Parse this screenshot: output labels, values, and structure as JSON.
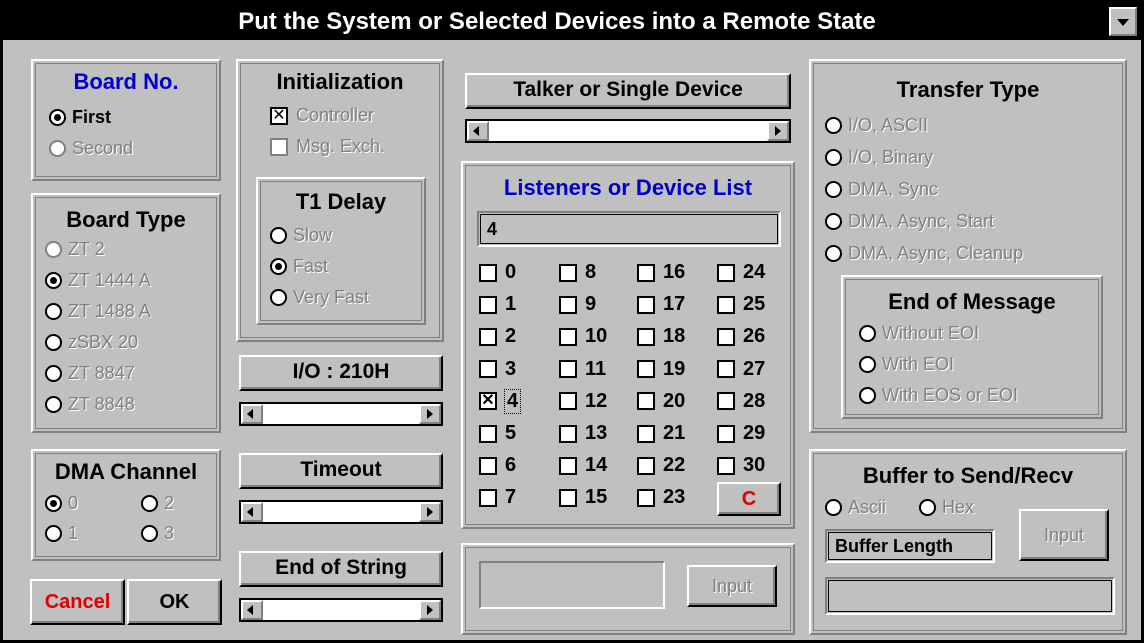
{
  "title": "Put the System or Selected Devices into a Remote State",
  "board_no": {
    "title": "Board No.",
    "options": [
      {
        "label": "First",
        "selected": true,
        "enabled": true
      },
      {
        "label": "Second",
        "selected": false,
        "enabled": false
      }
    ]
  },
  "board_type": {
    "title": "Board Type",
    "options": [
      {
        "label": "ZT 2",
        "selected": false
      },
      {
        "label": "ZT 1444 A",
        "selected": true
      },
      {
        "label": "ZT 1488 A",
        "selected": false
      },
      {
        "label": "zSBX 20",
        "selected": false
      },
      {
        "label": "ZT 8847",
        "selected": false
      },
      {
        "label": "ZT 8848",
        "selected": false
      }
    ]
  },
  "dma_channel": {
    "title": "DMA Channel",
    "options": [
      {
        "label": "0",
        "selected": true
      },
      {
        "label": "2",
        "selected": false
      },
      {
        "label": "1",
        "selected": false
      },
      {
        "label": "3",
        "selected": false
      }
    ]
  },
  "buttons": {
    "cancel": "Cancel",
    "ok": "OK"
  },
  "initialization": {
    "title": "Initialization",
    "controller": {
      "label": "Controller",
      "checked": true
    },
    "msg_exch": {
      "label": "Msg. Exch.",
      "checked": false
    }
  },
  "t1_delay": {
    "title": "T1 Delay",
    "options": [
      {
        "label": "Slow",
        "selected": false
      },
      {
        "label": "Fast",
        "selected": true
      },
      {
        "label": "Very Fast",
        "selected": false
      }
    ]
  },
  "io": {
    "label": "I/O : 210H"
  },
  "timeout": {
    "label": "Timeout"
  },
  "end_of_string": {
    "label": "End of String"
  },
  "talker": {
    "label": "Talker or Single Device"
  },
  "listeners": {
    "title": "Listeners or Device List",
    "value": "4",
    "checked": [
      4
    ],
    "clear_label": "C"
  },
  "bottom_input": {
    "label": "Input"
  },
  "transfer_type": {
    "title": "Transfer Type",
    "options": [
      {
        "label": "I/O, ASCII",
        "selected": false
      },
      {
        "label": "I/O, Binary",
        "selected": false
      },
      {
        "label": "DMA, Sync",
        "selected": false
      },
      {
        "label": "DMA, Async, Start",
        "selected": false
      },
      {
        "label": "DMA, Async, Cleanup",
        "selected": false
      }
    ]
  },
  "end_of_message": {
    "title": "End of Message",
    "options": [
      {
        "label": "Without EOI",
        "selected": false
      },
      {
        "label": "With EOI",
        "selected": false
      },
      {
        "label": "With EOS or EOI",
        "selected": false
      }
    ]
  },
  "buffer": {
    "title": "Buffer to Send/Recv",
    "ascii": "Ascii",
    "hex": "Hex",
    "length_label": "Buffer Length",
    "input_label": "Input"
  }
}
